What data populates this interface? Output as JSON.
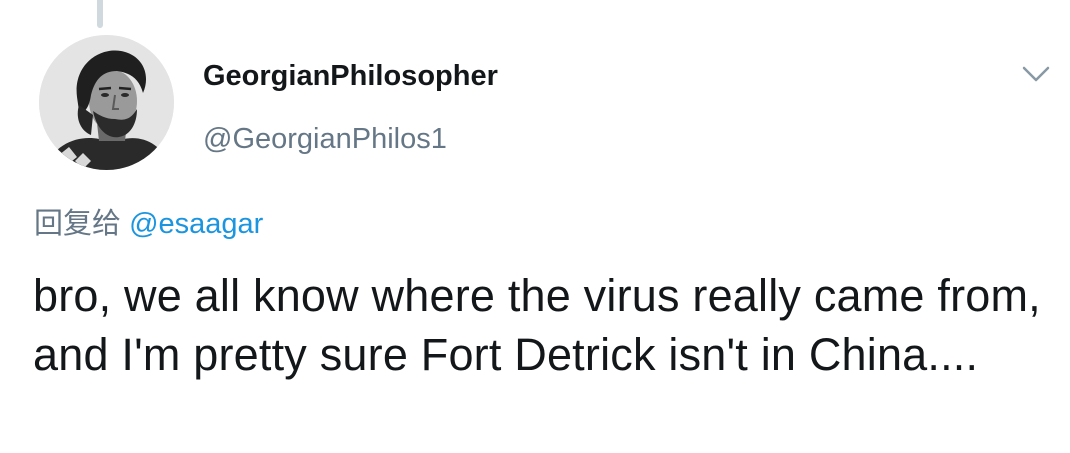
{
  "tweet": {
    "author": {
      "display_name": "GeorgianPhilosopher",
      "handle": "@GeorgianPhilos1",
      "avatar_icon": "portrait-avatar"
    },
    "reply_prefix": "回复给",
    "reply_to": "@esaagar",
    "text": "bro, we all know where the virus really came from, and I'm pretty sure Fort Detrick isn't in China....",
    "menu_icon": "chevron-down-icon"
  },
  "colors": {
    "text_primary": "#14171a",
    "text_secondary": "#657786",
    "link": "#1b95e0",
    "thread_line": "#cfd9de"
  }
}
